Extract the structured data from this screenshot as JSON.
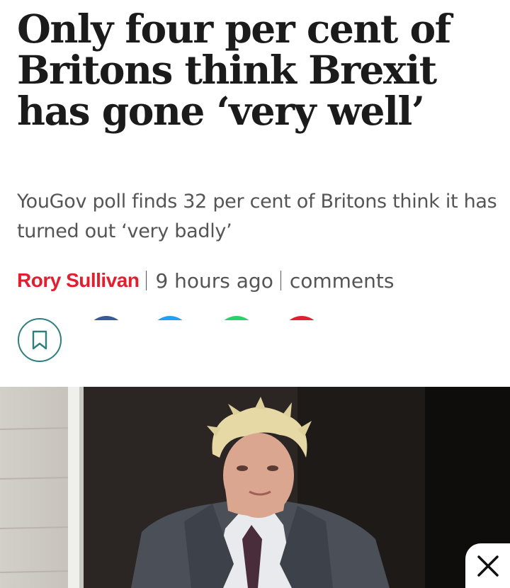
{
  "article": {
    "headline": "Only four per cent of Britons think Brexit has gone ‘very well’",
    "standfirst": "YouGov poll finds 32 per cent of Britons think it has turned out ‘very badly’",
    "author": "Rory Sullivan",
    "time_ago": "9 hours ago",
    "comments_label": "comments"
  },
  "actions": {
    "bookmark_icon": "bookmark-icon",
    "share_buttons": [
      {
        "icon": "facebook-icon",
        "color": "#3b5998"
      },
      {
        "icon": "twitter-icon",
        "color": "#1da1f2"
      },
      {
        "icon": "whatsapp-icon",
        "color": "#25d366"
      },
      {
        "icon": "email-icon",
        "color": "#e0202e"
      }
    ]
  },
  "hero_image": {
    "description_icon": "photo-image"
  },
  "overlay": {
    "close_icon": "close-icon"
  },
  "colors": {
    "accent_red": "#e0202e",
    "bookmark_teal": "#2e7f7e",
    "headline": "#1b1b1b",
    "body_gray": "#555555"
  }
}
